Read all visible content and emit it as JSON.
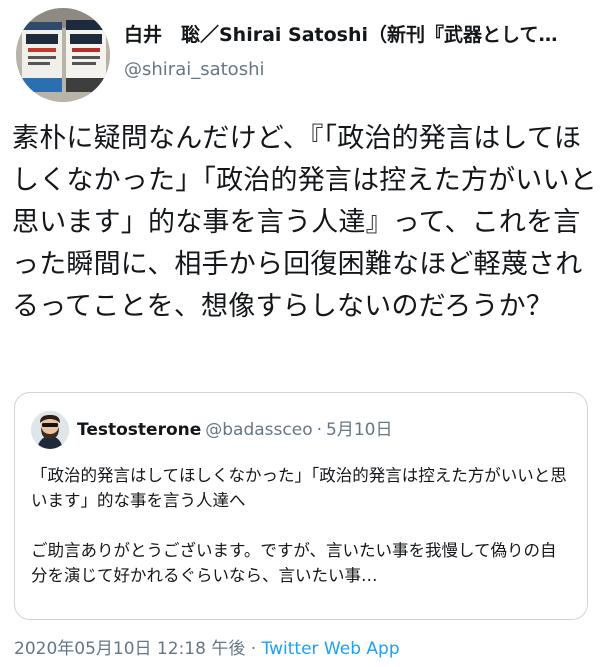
{
  "author": {
    "display_name": "白井　聡／Shirai Satoshi（新刊『武器として…",
    "handle": "@shirai_satoshi"
  },
  "tweet": {
    "text": "素朴に疑問なんだけど、『「政治的発言はしてほしくなかった」「政治的発言は控えた方がいいと思います」的な事を言う人達』って、これを言った瞬間に、相手から回復困難なほど軽蔑されるってことを、想像すらしないのだろうか？"
  },
  "quoted_tweet": {
    "display_name": "Testosterone",
    "handle": "@badassceo",
    "separator": "·",
    "date": "5月10日",
    "paragraph_1": "「政治的発言はしてほしくなかった」「政治的発言は控えた方がいいと思います」的な事を言う人達へ",
    "paragraph_2": "ご助言ありがとうございます。ですが、言いたい事を我慢して偽りの自分を演じて好かれるぐらいなら、言いたい事…"
  },
  "footer": {
    "timestamp": "2020年05月10日 12:18 午後",
    "separator": "·",
    "source": "Twitter Web App",
    "source_color": "#1da1f2"
  },
  "icons": {
    "author_avatar": "book-covers-avatar-icon",
    "quoted_avatar": "bearded-man-avatar-icon"
  }
}
